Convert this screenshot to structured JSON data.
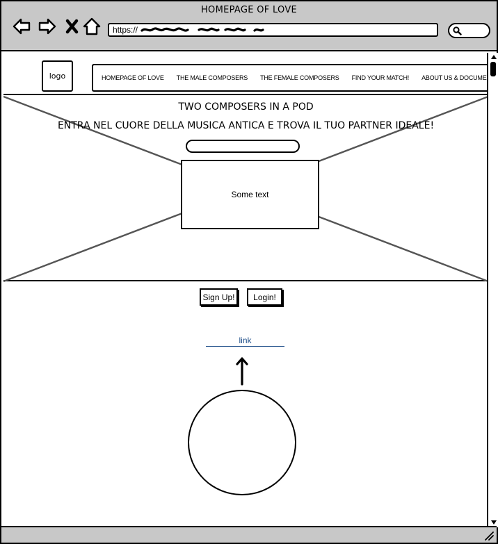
{
  "window": {
    "title": "HOMEPAGE OF LOVE",
    "url_prefix": "https://",
    "icons": [
      "back-icon",
      "forward-icon",
      "close-icon",
      "home-icon",
      "search-icon"
    ]
  },
  "header": {
    "logo_label": "logo",
    "menu": [
      {
        "label": "HOMEPAGE OF LOVE"
      },
      {
        "label": "THE MALE COMPOSERS"
      },
      {
        "label": "THE FEMALE COMPOSERS"
      },
      {
        "label": "FIND YOUR MATCH!"
      },
      {
        "label": "ABOUT US & DOCUMENTAZIONE"
      }
    ]
  },
  "hero": {
    "title": "TWO COMPOSERS IN A POD",
    "subtitle": "ENTRA NEL CUORE DELLA MUSICA ANTICA E TROVA IL TUO PARTNER IDEALE!",
    "input_value": "",
    "box_text": "Some text"
  },
  "actions": {
    "signup_label": "Sign Up!",
    "login_label": "Login!",
    "link_label": "link"
  },
  "colors": {
    "chrome": "#c8c8c8",
    "link": "#1f4f8a"
  }
}
